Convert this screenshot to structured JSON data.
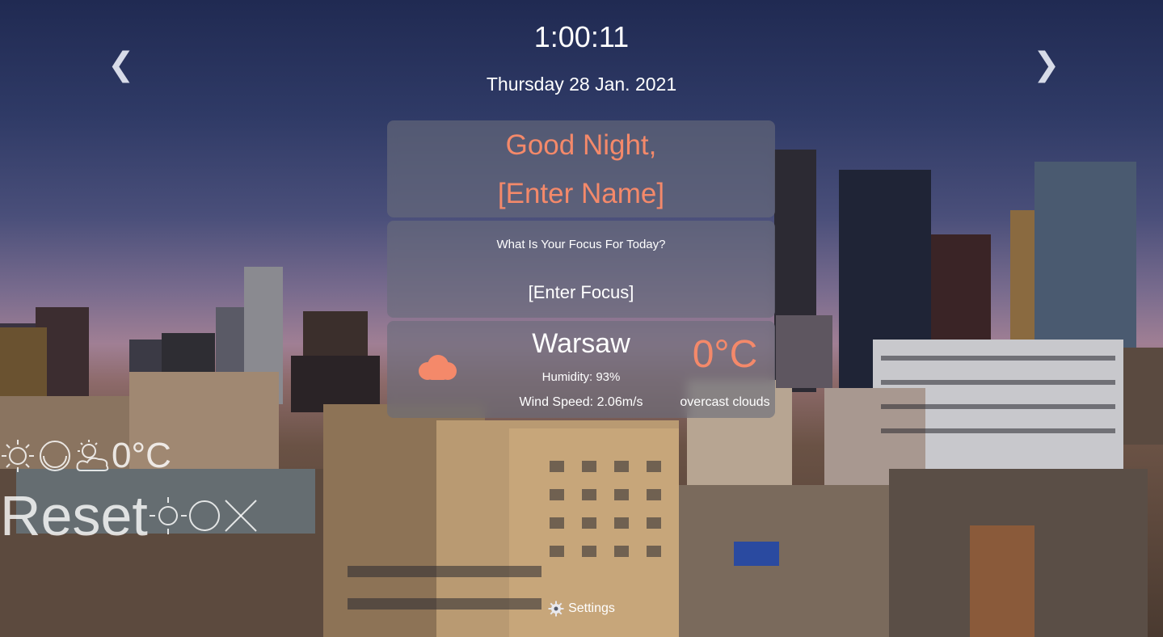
{
  "clock": {
    "time": "1:00:11",
    "date": "Thursday 28 Jan. 2021"
  },
  "nav": {
    "prev_icon": "chevron-left-icon",
    "prev_glyph": "❮",
    "next_icon": "chevron-right-icon",
    "next_glyph": "❯"
  },
  "greeting": {
    "salutation": "Good Night,",
    "name": "[Enter Name]"
  },
  "focus": {
    "question": "What Is Your Focus For Today?",
    "value": "[Enter Focus]"
  },
  "weather": {
    "city": "Warsaw",
    "humidity": "Humidity: 93%",
    "wind": "Wind Speed: 2.06m/s",
    "temperature": "0°C",
    "description": "overcast clouds",
    "icon": "cloud-icon"
  },
  "side_widget": {
    "temperature": "0°C",
    "icons": [
      "sun-outline-icon",
      "moon-outline-icon",
      "partly-cloudy-icon"
    ]
  },
  "reset": {
    "label": "Reset",
    "icons": [
      "sun-outline-icon",
      "moon-outline-icon",
      "close-icon"
    ]
  },
  "settings": {
    "label": "Settings",
    "icon": "gear-icon"
  },
  "colors": {
    "accent": "#f4896a",
    "panel": "#696c7a",
    "text": "#ffffff"
  }
}
